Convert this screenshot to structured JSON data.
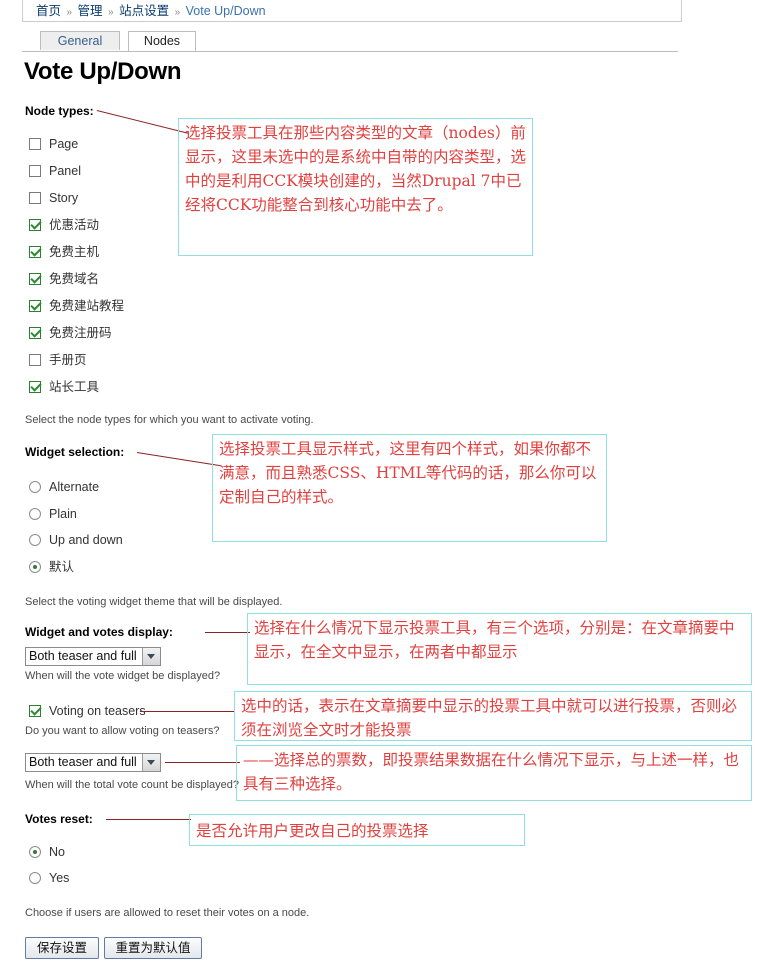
{
  "breadcrumb": {
    "items": [
      "首页",
      "管理",
      "站点设置",
      "Vote Up/Down"
    ],
    "separator": "»"
  },
  "tabs": [
    {
      "label": "General",
      "active": false
    },
    {
      "label": "Nodes",
      "active": true
    }
  ],
  "page_title": "Vote Up/Down",
  "sections": {
    "node_types": {
      "label": "Node types:",
      "description": "Select the node types for which you want to activate voting.",
      "options": [
        {
          "label": "Page",
          "checked": false
        },
        {
          "label": "Panel",
          "checked": false
        },
        {
          "label": "Story",
          "checked": false
        },
        {
          "label": "优惠活动",
          "checked": true
        },
        {
          "label": "免费主机",
          "checked": true
        },
        {
          "label": "免费域名",
          "checked": true
        },
        {
          "label": "免费建站教程",
          "checked": true
        },
        {
          "label": "免费注册码",
          "checked": true
        },
        {
          "label": "手册页",
          "checked": false
        },
        {
          "label": "站长工具",
          "checked": true
        }
      ]
    },
    "widget_selection": {
      "label": "Widget selection:",
      "description": "Select the voting widget theme that will be displayed.",
      "options": [
        {
          "label": "Alternate",
          "selected": false
        },
        {
          "label": "Plain",
          "selected": false
        },
        {
          "label": "Up and down",
          "selected": false
        },
        {
          "label": "默认",
          "selected": true
        }
      ]
    },
    "widget_votes_display": {
      "label": "Widget and votes display:",
      "widget_select_value": "Both teaser and full",
      "widget_select_description": "When will the vote widget be displayed?",
      "teaser_checkbox": {
        "label": "Voting on teasers",
        "checked": true
      },
      "teaser_description": "Do you want to allow voting on teasers?",
      "count_select_value": "Both teaser and full",
      "count_select_description": "When will the total vote count be displayed?"
    },
    "votes_reset": {
      "label": "Votes reset:",
      "description": "Choose if users are allowed to reset their votes on a node.",
      "options": [
        {
          "label": "No",
          "selected": true
        },
        {
          "label": "Yes",
          "selected": false
        }
      ]
    }
  },
  "actions": {
    "save_label": "保存设置",
    "reset_label": "重置为默认值"
  },
  "annotations": {
    "node_types": "选择投票工具在那些内容类型的文章（nodes）前显示，这里未选中的是系统中自带的内容类型，选中的是利用CCK模块创建的，当然Drupal 7中已经将CCK功能整合到核心功能中去了。",
    "widget_selection": "选择投票工具显示样式，这里有四个样式，如果你都不满意，而且熟悉CSS、HTML等代码的话，那么你可以定制自己的样式。",
    "widget_display": "选择在什么情况下显示投票工具，有三个选项，分别是：在文章摘要中显示，在全文中显示，在两者中都显示",
    "voting_on_teasers": "选中的话，表示在文章摘要中显示的投票工具中就可以进行投票，否则必须在浏览全文时才能投票",
    "vote_count_display": "——选择总的票数，即投票结果数据在什么情况下显示，与上述一样，也具有三种选择。",
    "votes_reset": "是否允许用户更改自己的投票选择"
  },
  "colors": {
    "annotation_text": "#e0413f",
    "annotation_border": "#8fe0e0",
    "leader_line": "#8c2222",
    "link": "#35618e",
    "checkbox_check": "#2a8a2f"
  }
}
